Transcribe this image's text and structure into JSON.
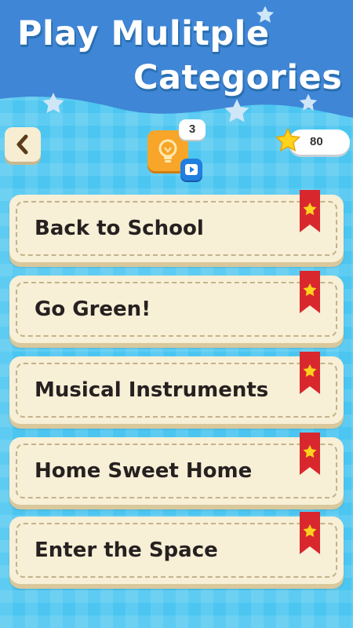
{
  "header": {
    "title_line1": "Play Mulitple",
    "title_line2": "Categories"
  },
  "toolbar": {
    "hint_count": "3",
    "coins": "80"
  },
  "categories": [
    {
      "label": "Back to School"
    },
    {
      "label": "Go Green!"
    },
    {
      "label": "Musical Instruments"
    },
    {
      "label": "Home Sweet Home"
    },
    {
      "label": "Enter the Space"
    }
  ],
  "colors": {
    "header_blue": "#3f86d6",
    "background_blue": "#4cc6f0",
    "card_cream": "#f7efd6",
    "ribbon_red": "#d8282e",
    "star_yellow": "#ffd21e",
    "hint_orange": "#f7a62a"
  },
  "icons": {
    "back": "chevron-left-icon",
    "hint": "lightbulb-icon",
    "video": "play-video-icon",
    "coins": "star-icon",
    "ribbon": "bookmark-ribbon-icon"
  }
}
